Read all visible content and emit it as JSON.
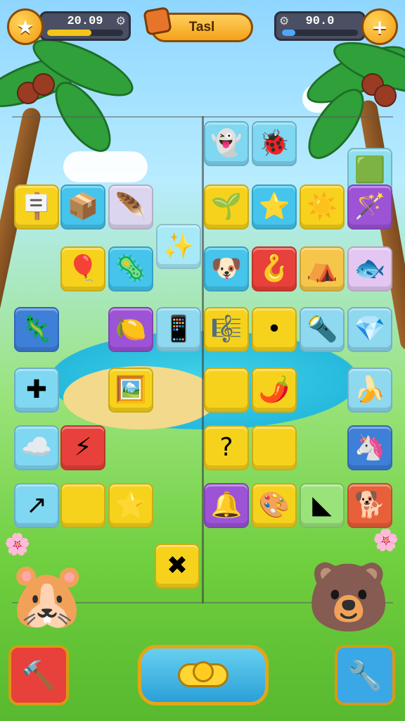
{
  "hud": {
    "left_stat": {
      "value": "20.09",
      "icon": "star-icon",
      "progress": 0.58,
      "color": "#f3c51a"
    },
    "task": {
      "label": "Tasl",
      "icon": "box-icon"
    },
    "right_stat": {
      "value": "90.0",
      "icon": "plus-icon",
      "progress": 0.18,
      "color": "#4fa8ff"
    },
    "left_round_glyph": "★",
    "right_round_glyph": "+",
    "left_box_glyph": "⚙",
    "right_box_glyph": "⚙"
  },
  "board": {
    "tiles": [
      {
        "name": "ghost-tile",
        "glyph": "👻",
        "color": "#7fd7f2"
      },
      {
        "name": "bug-tile",
        "glyph": "🐞",
        "color": "#7fd7f2"
      },
      {
        "name": "green-block-tile",
        "glyph": "🟩",
        "color": "#8ee0ef"
      },
      {
        "name": "sign-tile",
        "glyph": "🪧",
        "color": "#f7d21c"
      },
      {
        "name": "crate-tile",
        "glyph": "📦",
        "color": "#45c4ec"
      },
      {
        "name": "feather-tile",
        "glyph": "🪶",
        "color": "#dcd5f0"
      },
      {
        "name": "star-sparkle-tile",
        "glyph": "✨",
        "color": "#a7e9f7"
      },
      {
        "name": "sprout-tile",
        "glyph": "🌱",
        "color": "#f7d21c"
      },
      {
        "name": "star-tile",
        "glyph": "⭐",
        "color": "#45c4ec"
      },
      {
        "name": "sun-tile",
        "glyph": "☀️",
        "color": "#f7d21c"
      },
      {
        "name": "wand-tile",
        "glyph": "🪄",
        "color": "#9d53d6"
      },
      {
        "name": "leaf-tile",
        "glyph": "🍂",
        "color": "#8ed8f0"
      },
      {
        "name": "balloon-tile",
        "glyph": "🎈",
        "color": "#f7d21c"
      },
      {
        "name": "pink-creature-tile",
        "glyph": "🦠",
        "color": "#45c4ec"
      },
      {
        "name": "puppy-face-tile",
        "glyph": "🐶",
        "color": "#45c4ec"
      },
      {
        "name": "hook-tile",
        "glyph": "🪝",
        "color": "#e8403a"
      },
      {
        "name": "tent-tile",
        "glyph": "⛺",
        "color": "#f5c64a"
      },
      {
        "name": "green-fish-tile",
        "glyph": "🐟",
        "color": "#e3c7f2"
      },
      {
        "name": "dragon-tile",
        "glyph": "🦎",
        "color": "#3e7fd8"
      },
      {
        "name": "lemon-tile",
        "glyph": "🍋",
        "color": "#9d53d6"
      },
      {
        "name": "phone-tile",
        "glyph": "📱",
        "color": "#8ed8f0"
      },
      {
        "name": "harp-tile",
        "glyph": "🎼",
        "color": "#f7d21c"
      },
      {
        "name": "dot-tile",
        "glyph": "•",
        "color": "#f7d21c"
      },
      {
        "name": "torch-tile",
        "glyph": "🔦",
        "color": "#8ed8f0"
      },
      {
        "name": "gem-tile",
        "glyph": "💎",
        "color": "#8ed8f0"
      },
      {
        "name": "cross-tile",
        "glyph": "✚",
        "color": "#7fd7f2"
      },
      {
        "name": "frame-tile",
        "glyph": "🖼️",
        "color": "#f7d21c"
      },
      {
        "name": "blank-yellow-tile",
        "glyph": "",
        "color": "#f7d21c"
      },
      {
        "name": "pepper-tile",
        "glyph": "🌶️",
        "color": "#f7d21c"
      },
      {
        "name": "banana-tile",
        "glyph": "🍌",
        "color": "#8ed8f0"
      },
      {
        "name": "lightning-tile",
        "glyph": "⚡",
        "color": "#e8403a"
      },
      {
        "name": "question-tile",
        "glyph": "?",
        "color": "#f7d21c"
      },
      {
        "name": "plain-yellow-tile",
        "glyph": "",
        "color": "#f7d21c"
      },
      {
        "name": "seahorse-tile",
        "glyph": "🦄",
        "color": "#3e7fd8"
      },
      {
        "name": "cloud-tile",
        "glyph": "☁️",
        "color": "#7fd7f2"
      },
      {
        "name": "arrow-tile",
        "glyph": "↗",
        "color": "#7fd7f2"
      },
      {
        "name": "empty-yellow-tile",
        "glyph": "",
        "color": "#f7d21c"
      },
      {
        "name": "red-star-tile",
        "glyph": "⭐",
        "color": "#f7d21c"
      },
      {
        "name": "bell-tile",
        "glyph": "🔔",
        "color": "#9d53d6"
      },
      {
        "name": "easel-tile",
        "glyph": "🎨",
        "color": "#f7d21c"
      },
      {
        "name": "shape-tile",
        "glyph": "◣",
        "color": "#9ae37b"
      },
      {
        "name": "dog-tile",
        "glyph": "🐕",
        "color": "#e8603a"
      },
      {
        "name": "cross-bone-tile",
        "glyph": "✖",
        "color": "#f7d21c"
      }
    ]
  },
  "bottom": {
    "left_button": {
      "glyph": "🔨",
      "color": "#e8403a"
    },
    "center_button": {
      "color": "#2aa0d8"
    },
    "right_button": {
      "glyph": "🔧",
      "color": "#3aa8e6"
    }
  },
  "animals": {
    "left": {
      "glyph": "🐹"
    },
    "right": {
      "glyph": "🐻"
    }
  }
}
